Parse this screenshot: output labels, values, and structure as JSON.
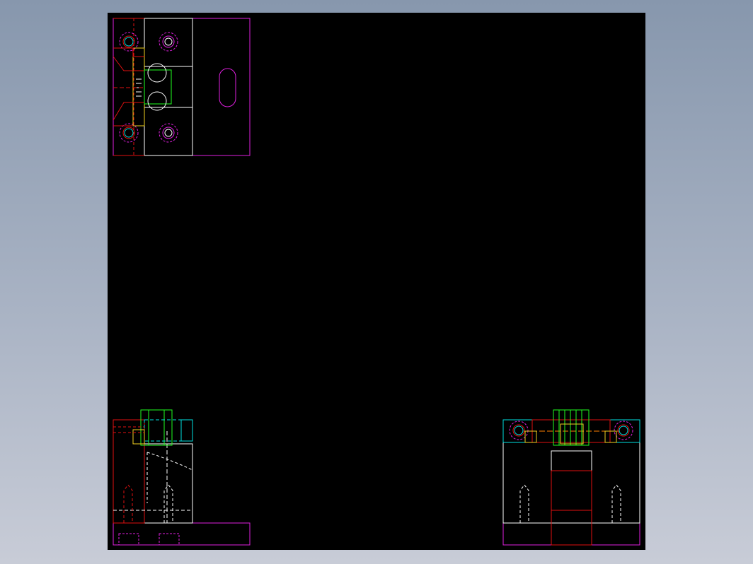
{
  "app": {
    "colors": {
      "background_top": "#8797ad",
      "background_bottom": "#c8ccd7",
      "viewport": "#000000",
      "magenta": "#e020e0",
      "white": "#ffffff",
      "red": "#e01010",
      "green": "#20ff20",
      "yellow": "#f0d020",
      "cyan": "#00e0e0",
      "orange": "#ff8000"
    },
    "views": [
      {
        "name": "top-view",
        "label": ""
      },
      {
        "name": "front-view",
        "label": ""
      },
      {
        "name": "side-view",
        "label": ""
      }
    ]
  }
}
